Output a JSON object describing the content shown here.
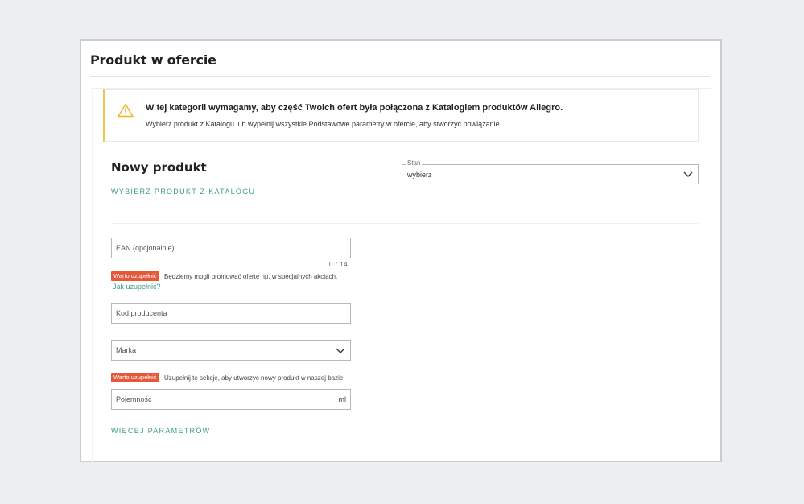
{
  "card": {
    "title": "Produkt w ofercie"
  },
  "alert": {
    "icon": "warning-icon",
    "title": "W tej kategorii wymagamy, aby część Twoich ofert była połączona z Katalogiem produktów Allegro.",
    "text": "Wybierz produkt z Katalogu lub wypełnij wszystkie Podstawowe parametry w ofercie, aby stworzyć powiązanie.",
    "accent_color": "#f4c244"
  },
  "product": {
    "title": "Nowy produkt",
    "catalog_link": "WYBIERZ PRODUKT Z KATALOGU"
  },
  "stan": {
    "label": "Stan",
    "value": "wybierz"
  },
  "ean": {
    "placeholder": "EAN (opcjonalnie)",
    "counter": "0  /  14",
    "badge": "Warto uzupełnić",
    "hint": "Będziemy mogli promować ofertę np. w specjalnych akcjach.",
    "help_link": "Jak uzupełnić?"
  },
  "kod_producenta": {
    "placeholder": "Kod producenta"
  },
  "marka": {
    "placeholder": "Marka"
  },
  "section_hint": {
    "badge": "Warto uzupełnić",
    "text": "Uzupełnij tę sekcję, aby utworzyć nowy produkt w naszej bazie."
  },
  "pojemnosc": {
    "placeholder": "Pojemność",
    "unit": "ml"
  },
  "more_params": "WIĘCEJ PARAMETRÓW",
  "colors": {
    "link": "#3d9c8a",
    "badge": "#e5583a"
  }
}
